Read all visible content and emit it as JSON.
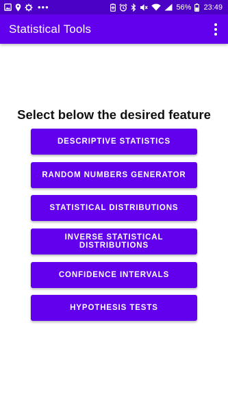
{
  "status_bar": {
    "battery_percent": "56%",
    "time": "23:49",
    "left_icons": [
      "image-icon",
      "location-icon",
      "settings-icon"
    ],
    "more_indicator": "•••",
    "right_icons": [
      "battery-saver-icon",
      "alarm-icon",
      "bluetooth-icon",
      "mute-icon",
      "wifi-icon",
      "signal-icon",
      "battery-icon"
    ]
  },
  "app_bar": {
    "title": "Statistical Tools",
    "menu_icon": "overflow-menu-icon"
  },
  "main": {
    "heading": "Select below the desired feature",
    "buttons": [
      {
        "label": "DESCRIPTIVE STATISTICS"
      },
      {
        "label": "RANDOM NUMBERS GENERATOR"
      },
      {
        "label": "STATISTICAL DISTRIBUTIONS"
      },
      {
        "label": "INVERSE STATISTICAL DISTRIBUTIONS"
      },
      {
        "label": "CONFIDENCE INTERVALS"
      },
      {
        "label": "HYPOTHESIS TESTS"
      }
    ]
  },
  "colors": {
    "primary": "#6200ee",
    "primary_dark": "#4c02c4",
    "on_primary": "#ffffff",
    "background": "#ffffff",
    "heading_text": "#111111"
  }
}
